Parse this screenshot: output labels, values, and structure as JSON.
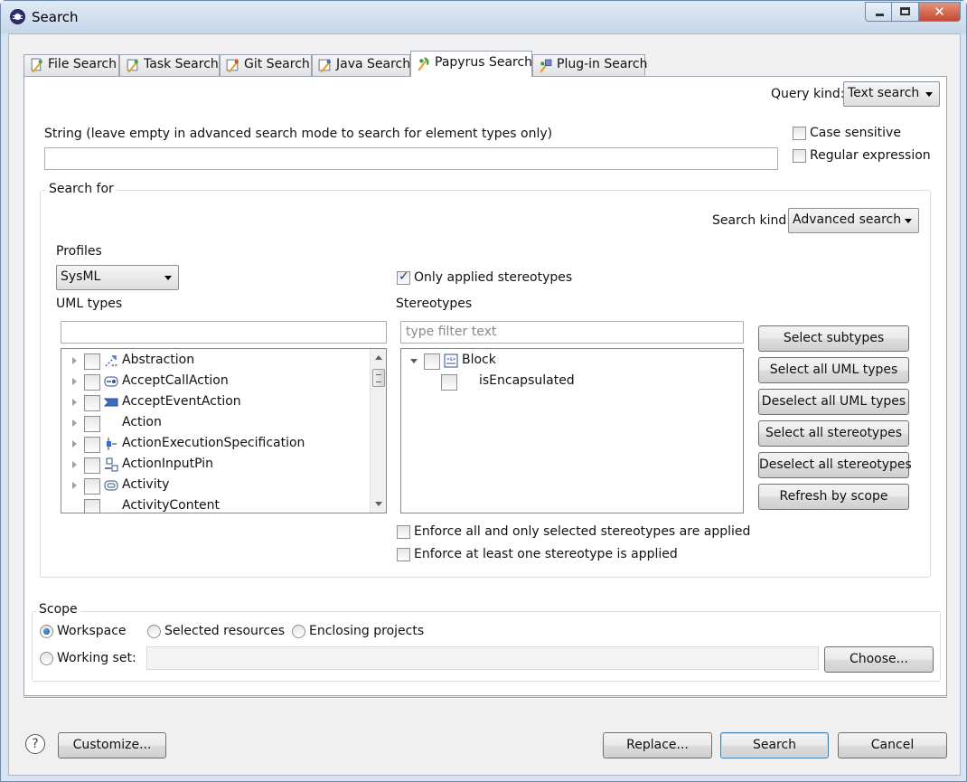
{
  "window": {
    "title": "Search",
    "close_glyph": "✕"
  },
  "tabs": [
    {
      "label": "File Search",
      "icon": "file-search-icon"
    },
    {
      "label": "Task Search",
      "icon": "task-search-icon"
    },
    {
      "label": "Git Search",
      "icon": "git-search-icon"
    },
    {
      "label": "Java Search",
      "icon": "java-search-icon"
    },
    {
      "label": "Papyrus Search",
      "icon": "papyrus-search-icon",
      "active": true
    },
    {
      "label": "Plug-in Search",
      "icon": "plugin-search-icon"
    }
  ],
  "query_kind": {
    "label": "Query kind:",
    "value": "Text search"
  },
  "string_field": {
    "label": "String (leave empty in advanced search mode to search for element types only)",
    "value": ""
  },
  "options": {
    "case_sensitive": {
      "label": "Case sensitive",
      "checked": false
    },
    "regular_expression": {
      "label": "Regular expression",
      "checked": false
    }
  },
  "search_for": {
    "group_label": "Search for",
    "search_kind": {
      "label": "Search kind:",
      "value": "Advanced search"
    },
    "profiles": {
      "label": "Profiles",
      "value": "SysML"
    },
    "only_applied_stereotypes": {
      "label": "Only applied stereotypes",
      "checked": true
    },
    "uml_types": {
      "label": "UML types",
      "filter_value": "",
      "items": [
        {
          "label": "Abstraction",
          "icon": "abstraction-icon",
          "expandable": true
        },
        {
          "label": "AcceptCallAction",
          "icon": "accept-call-action-icon",
          "expandable": true
        },
        {
          "label": "AcceptEventAction",
          "icon": "accept-event-action-icon",
          "expandable": true
        },
        {
          "label": "Action",
          "icon": "",
          "expandable": true
        },
        {
          "label": "ActionExecutionSpecification",
          "icon": "action-execution-specification-icon",
          "expandable": true
        },
        {
          "label": "ActionInputPin",
          "icon": "action-input-pin-icon",
          "expandable": true
        },
        {
          "label": "Activity",
          "icon": "activity-icon",
          "expandable": true
        },
        {
          "label": "ActivityContent",
          "icon": "",
          "expandable": false
        }
      ]
    },
    "stereotypes": {
      "label": "Stereotypes",
      "filter_placeholder": "type filter text",
      "tree": [
        {
          "label": "Block",
          "icon": "block-stereotype-icon",
          "expanded": true,
          "level": 0
        },
        {
          "label": "isEncapsulated",
          "icon": "",
          "expanded": false,
          "level": 1
        }
      ]
    },
    "buttons": {
      "select_subtypes": "Select subtypes",
      "select_all_uml_types": "Select all UML types",
      "deselect_all_uml_types": "Deselect all UML types",
      "select_all_stereotypes": "Select all stereotypes",
      "deselect_all_stereotypes": "Deselect all stereotypes",
      "refresh_by_scope": "Refresh by scope"
    },
    "enforce_all": {
      "label": "Enforce all and only selected stereotypes are applied",
      "checked": false
    },
    "enforce_one": {
      "label": "Enforce at least one stereotype is applied",
      "checked": false
    }
  },
  "scope": {
    "label": "Scope",
    "workspace": {
      "label": "Workspace",
      "checked": true
    },
    "selected_resources": {
      "label": "Selected resources",
      "checked": false
    },
    "enclosing_projects": {
      "label": "Enclosing projects",
      "checked": false
    },
    "working_set": {
      "label": "Working set:",
      "checked": false,
      "value": ""
    },
    "choose_button": "Choose..."
  },
  "footer": {
    "help_glyph": "?",
    "customize": "Customize...",
    "replace": "Replace...",
    "search": "Search",
    "cancel": "Cancel"
  },
  "colors": {
    "title_bar": "#c7d7ea",
    "close_button": "#c44a2e",
    "default_button_border": "#3c7fb1"
  }
}
